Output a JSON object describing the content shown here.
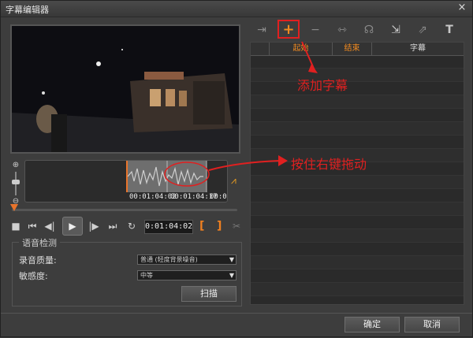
{
  "window": {
    "title": "字幕编辑器",
    "close_glyph": "×"
  },
  "timeline": {
    "times": [
      "00:01:04:02",
      "00:01:04:17",
      "00:01:0"
    ],
    "position_fraction": 0.0
  },
  "controls": {
    "timecode": "0:01:04:02",
    "mark_in": "[",
    "mark_out": "]"
  },
  "voice_detection": {
    "legend": "语音检测",
    "quality_label": "录音质量:",
    "quality_value": "普通 (轻度背景噪音)",
    "sensitivity_label": "敏感度:",
    "sensitivity_value": "中等",
    "scan_label": "扫描"
  },
  "subtitle_table": {
    "columns": [
      "",
      "起始",
      "结束",
      "字幕"
    ],
    "row_count": 19
  },
  "annotations": {
    "add_subtitle": "添加字幕",
    "drag_hint": "按住右键拖动"
  },
  "footer": {
    "ok_label": "确定",
    "cancel_label": "取消"
  },
  "icons": {
    "toolbar": [
      "import-icon",
      "add-subtitle-icon",
      "remove-subtitle-icon",
      "merge-icon",
      "split-icon",
      "export-icon",
      "share-icon",
      "text-format-icon"
    ]
  },
  "colors": {
    "accent": "#e8742c",
    "annotation": "#e02020"
  }
}
